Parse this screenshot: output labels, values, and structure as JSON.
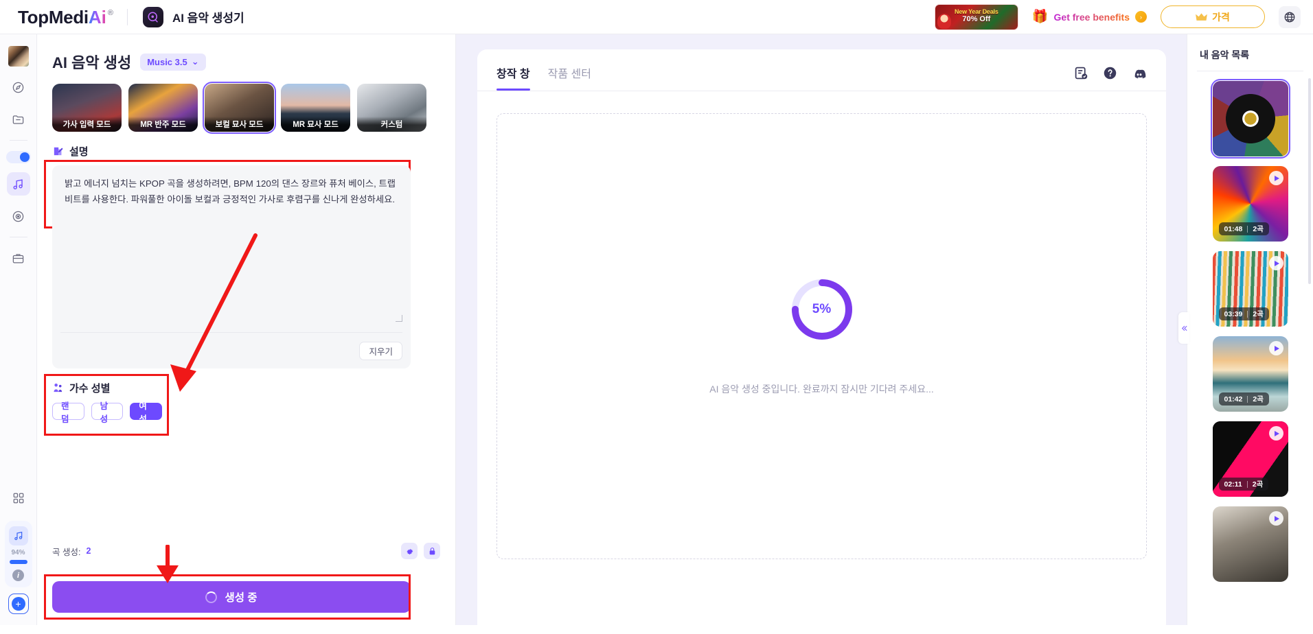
{
  "header": {
    "brand_main": "TopMedi",
    "brand_ai": "Ai",
    "brand_reg": "®",
    "app_icon": "music-disc-icon",
    "app_title": "AI 음악 생성기",
    "promo": {
      "line1": "New Year Deals",
      "line2": "70% Off"
    },
    "benefits_label": "Get free benefits",
    "benefits_arrow": "›",
    "gift_icon": "gift-icon",
    "price_label": "가격",
    "crown_icon": "crown-icon",
    "globe_icon": "globe-icon"
  },
  "rail": {
    "avatar": "user-avatar",
    "items": [
      {
        "name": "discover-icon",
        "glyph": "◍",
        "active": false
      },
      {
        "name": "folder-icon",
        "glyph": "🗀",
        "active": false
      },
      {
        "name": "music-note-icon",
        "glyph": "♫",
        "active": true
      },
      {
        "name": "disc-icon",
        "glyph": "◎",
        "active": false
      },
      {
        "name": "briefcase-icon",
        "glyph": "🝰",
        "active": false
      },
      {
        "name": "grid-apps-icon",
        "glyph": "▦",
        "active": false
      }
    ],
    "credit_percent": "94%",
    "info_glyph": "i",
    "plus_glyph": "+"
  },
  "form": {
    "title": "AI 음악 생성",
    "model": "Music 3.5",
    "model_chevron": "⌄",
    "modes": [
      {
        "label": "가사 입력 모드",
        "selected": false
      },
      {
        "label": "MR 반주 모드",
        "selected": false
      },
      {
        "label": "보컬 묘사 모드",
        "selected": true
      },
      {
        "label": "MR 묘사 모드",
        "selected": false
      },
      {
        "label": "커스텀",
        "selected": false
      }
    ],
    "description_section": {
      "icon": "document-edit-icon",
      "label": "설명",
      "text": "밝고 에너지 넘치는 KPOP 곡을 생성하려면, BPM 120의 댄스 장르와 퓨처 베이스, 트랩 비트를 사용한다. 파워풀한 아이돌 보컬과 긍정적인 가사로 후렴구를 신나게 완성하세요.",
      "clear_label": "지우기"
    },
    "gender_section": {
      "icon": "gender-people-icon",
      "label": "가수 성별",
      "options": [
        {
          "label": "랜덤",
          "selected": false
        },
        {
          "label": "남성",
          "selected": false
        },
        {
          "label": "여성",
          "selected": true
        }
      ]
    },
    "count_label": "곡 생성:",
    "count_value": "2",
    "settings_icon": "gear-icon",
    "lock_icon": "lock-icon",
    "generate_label": "생성 중",
    "generate_spinner": "loading-spinner-icon"
  },
  "center": {
    "tabs": [
      {
        "label": "창작 창",
        "active": true
      },
      {
        "label": "작품 센터",
        "active": false
      }
    ],
    "icons": [
      {
        "name": "task-check-icon"
      },
      {
        "name": "help-question-icon"
      },
      {
        "name": "discord-icon"
      }
    ],
    "progress_percent": 5,
    "progress_text": "5%",
    "loading_text": "AI 음악 생성 중입니다. 완료까지 잠시만 기다려 주세요...",
    "collapse_icon": "chevron-double-left-icon"
  },
  "right": {
    "title": "내 음악 목록",
    "tracks": [
      {
        "art": "a0",
        "duration": "",
        "count": "",
        "selected": true,
        "show_meta": false,
        "show_play": false
      },
      {
        "art": "a1",
        "duration": "01:48",
        "count": "2곡",
        "selected": false,
        "show_meta": true,
        "show_play": true
      },
      {
        "art": "a2",
        "duration": "03:39",
        "count": "2곡",
        "selected": false,
        "show_meta": true,
        "show_play": true
      },
      {
        "art": "a3",
        "duration": "01:42",
        "count": "2곡",
        "selected": false,
        "show_meta": true,
        "show_play": true
      },
      {
        "art": "a4",
        "duration": "02:11",
        "count": "2곡",
        "selected": false,
        "show_meta": true,
        "show_play": true
      },
      {
        "art": "a5",
        "duration": "",
        "count": "",
        "selected": false,
        "show_meta": false,
        "show_play": true
      }
    ]
  },
  "colors": {
    "accent_purple": "#6d4aff",
    "generate_button": "#8b4df0",
    "annotation_red": "#f01818",
    "center_bg": "#f1f0fb"
  }
}
